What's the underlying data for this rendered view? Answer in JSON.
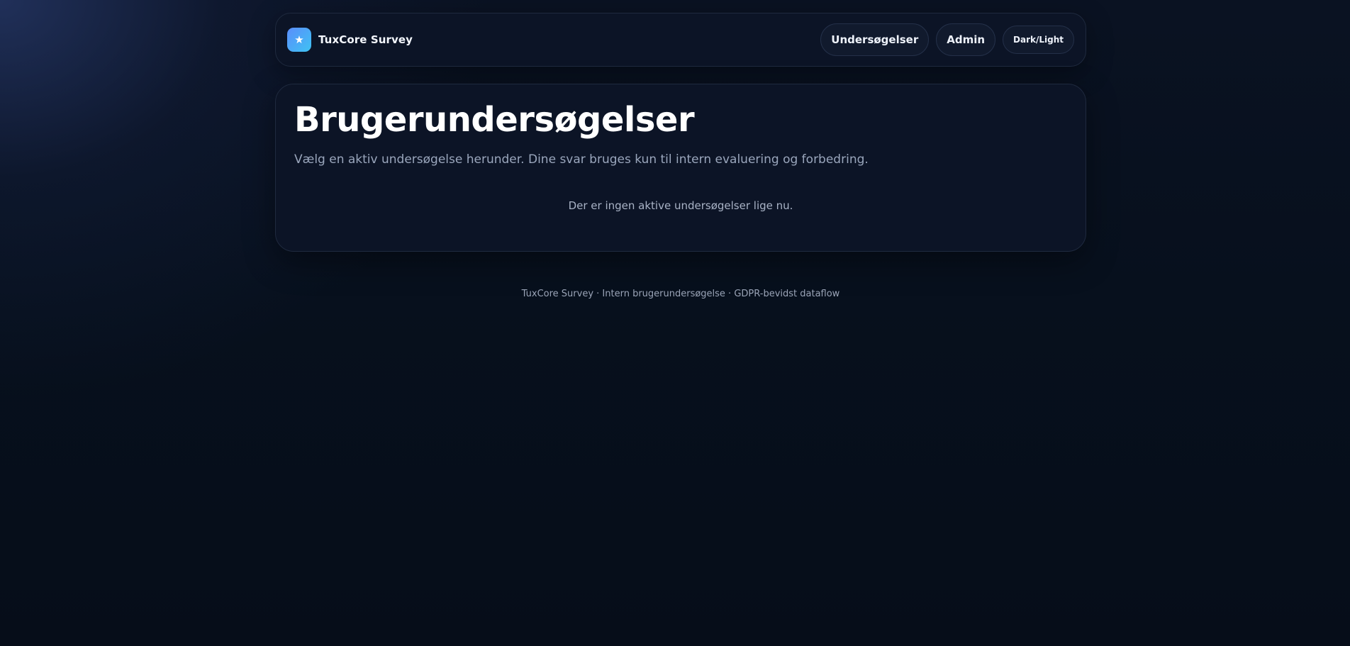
{
  "header": {
    "brand_icon": "star-icon",
    "brand_glyph": "★",
    "brand_name": "TuxCore Survey",
    "nav": {
      "surveys_label": "Undersøgelser",
      "admin_label": "Admin",
      "theme_label": "Dark/Light"
    }
  },
  "main": {
    "title": "Brugerundersøgelser",
    "subtitle": "Vælg en aktiv undersøgelse herunder. Dine svar bruges kun til intern evaluering og forbedring.",
    "empty_state": "Der er ingen aktive undersøgelser lige nu."
  },
  "footer": {
    "text": "TuxCore Survey · Intern brugerundersøgelse · GDPR-bevidst dataflow"
  },
  "colors": {
    "accent_start": "#5b8dfb",
    "accent_end": "#3ec3f3",
    "background": "#07101d",
    "card": "#0c1426"
  }
}
